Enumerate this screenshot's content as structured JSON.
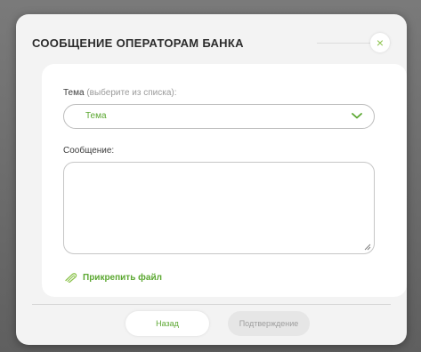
{
  "dialog": {
    "title": "СООБЩЕНИЕ ОПЕРАТОРАМ БАНКА",
    "close_symbol": "×"
  },
  "form": {
    "topic_label": "Тема",
    "topic_hint": "(выберите из списка):",
    "topic_selected": "Тема",
    "message_label": "Сообщение:",
    "message_value": "",
    "attach_label": "Прикрепить файл"
  },
  "buttons": {
    "back_label": "Назад",
    "confirm_label": "Подтверждение"
  },
  "colors": {
    "accent": "#5ca832",
    "close_accent": "#8cc34d"
  },
  "icons": {
    "close": "close-icon",
    "dropdown": "chevron-down-icon",
    "attach": "paperclip-icon",
    "resize": "resize-handle-icon"
  }
}
